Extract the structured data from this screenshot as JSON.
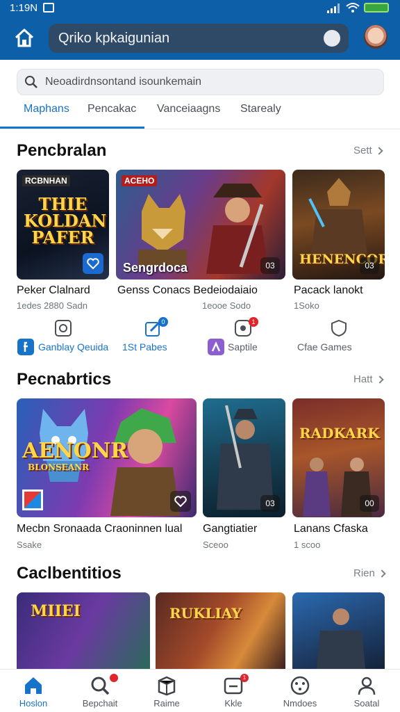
{
  "status_bar": {
    "time": "1:19N"
  },
  "header": {
    "search_text": "Qriko kpkaigunian"
  },
  "search": {
    "placeholder": "Neoadirdnsontand isounkemain"
  },
  "tabs": [
    {
      "label": "Maphans",
      "active": true
    },
    {
      "label": "Pencakac",
      "active": false
    },
    {
      "label": "Vanceiaagns",
      "active": false
    },
    {
      "label": "Starealy",
      "active": false
    }
  ],
  "sections": [
    {
      "title": "Pencbralan",
      "link": "Sett",
      "items": [
        {
          "cover_title": "THIE KOLDAN PAFER",
          "cover_tag": "RCBNHAN",
          "name": "Peker Clalnard",
          "sub": "1edes 2880 Sadn"
        },
        {
          "cover_title": "",
          "cover_tag": "ACEHO",
          "cover_caption": "Sengrdoca",
          "badge": "03",
          "name": "Genss Conacs Bedeiodaiaio",
          "sub": "1eooe Sodo"
        },
        {
          "cover_title": "HENENCOR",
          "cover_tag": "",
          "badge": "03",
          "name": "Pacack lanokt",
          "sub": "1Soko"
        }
      ],
      "quick_actions": [
        {
          "label": "Ganblay Qeuida",
          "icon": "facebook-icon"
        },
        {
          "label": "1St Pabes",
          "icon": "edit-icon",
          "dot": "0"
        },
        {
          "label": "Saptile",
          "icon": "spark-icon",
          "dot": "1"
        },
        {
          "label": "Cfae Games",
          "icon": "shield-icon"
        }
      ]
    },
    {
      "title": "Pecnabrtics",
      "link": "Hatt",
      "items": [
        {
          "cover_title": "AENONR",
          "cover_sub": "BLONSEANR",
          "name": "Mecbn Sronaada Craoninnen lual",
          "sub": "Ssake"
        },
        {
          "cover_title": "",
          "badge": "03",
          "name": "Gangtiatier",
          "sub": "Sceoo"
        },
        {
          "cover_title": "RADKARK",
          "badge": "00",
          "name": "Lanans Cfaska",
          "sub": "1 scoo"
        }
      ]
    },
    {
      "title": "Caclbentitios",
      "link": "Rien",
      "items": [
        {
          "cover_title": "MIIEI"
        },
        {
          "cover_title": "RUKLIAY"
        },
        {
          "cover_title": ""
        }
      ]
    }
  ],
  "bottom_nav": [
    {
      "label": "Hoslon",
      "icon": "home-icon",
      "active": true
    },
    {
      "label": "Bepchait",
      "icon": "search-icon",
      "dot": true
    },
    {
      "label": "Raime",
      "icon": "box-icon"
    },
    {
      "label": "Kkle",
      "icon": "minus-box-icon",
      "dot": "1"
    },
    {
      "label": "Nmdoes",
      "icon": "dial-icon"
    },
    {
      "label": "Soatal",
      "icon": "person-icon"
    }
  ],
  "colors": {
    "header": "#0d5fa8",
    "accent": "#1773c9",
    "badge_red": "#e0262b"
  }
}
